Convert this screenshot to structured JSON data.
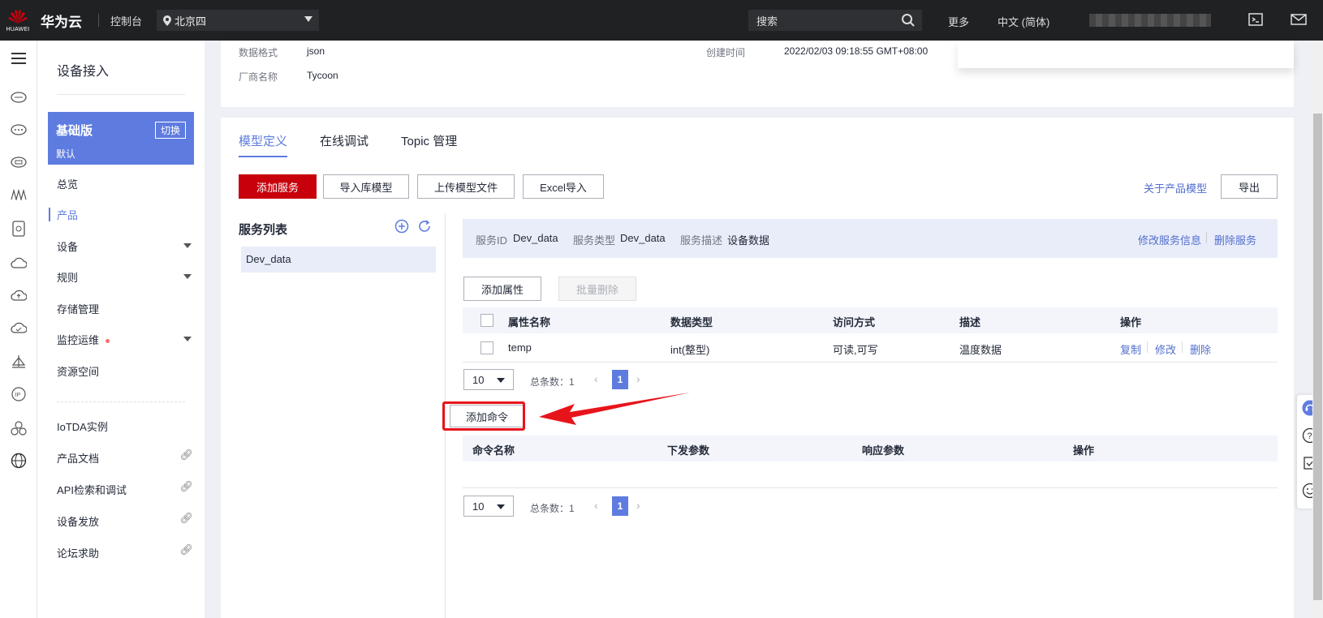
{
  "topbar": {
    "logo_text": "HUAWEI",
    "brand": "华为云",
    "console": "控制台",
    "region": "北京四",
    "search_placeholder": "搜索",
    "more": "更多",
    "language": "中文 (简体)"
  },
  "sidebar": {
    "title": "设备接入",
    "edition": {
      "name": "基础版",
      "sub": "默认",
      "switch": "切换"
    },
    "items": [
      {
        "label": "总览"
      },
      {
        "label": "产品",
        "active": true
      },
      {
        "label": "设备",
        "dropdown": true
      },
      {
        "label": "规则",
        "dropdown": true
      },
      {
        "label": "存储管理"
      },
      {
        "label": "监控运维",
        "dropdown": true,
        "dot": true
      },
      {
        "label": "资源空间"
      },
      {
        "label": "IoTDA实例"
      },
      {
        "label": "产品文档",
        "external": true
      },
      {
        "label": "API检索和调试",
        "external": true
      },
      {
        "label": "设备发放",
        "external": true
      },
      {
        "label": "论坛求助",
        "external": true
      }
    ]
  },
  "info": {
    "format_label": "数据格式",
    "format_value": "json",
    "vendor_label": "厂商名称",
    "vendor_value": "Tycoon",
    "created_label": "创建时间",
    "created_value": "2022/02/03 09:18:55 GMT+08:00"
  },
  "tabs": [
    "模型定义",
    "在线调试",
    "Topic 管理"
  ],
  "toolbar": {
    "add_service": "添加服务",
    "import_lib": "导入库模型",
    "upload_model": "上传模型文件",
    "excel_import": "Excel导入",
    "about_model": "关于产品模型",
    "export": "导出"
  },
  "service_list": {
    "title": "服务列表",
    "items": [
      "Dev_data"
    ]
  },
  "service_detail": {
    "id_label": "服务ID",
    "id_value": "Dev_data",
    "type_label": "服务类型",
    "type_value": "Dev_data",
    "desc_label": "服务描述",
    "desc_value": "设备数据",
    "edit": "修改服务信息",
    "delete": "删除服务"
  },
  "properties": {
    "add": "添加属性",
    "batch_delete": "批量删除",
    "columns": [
      "属性名称",
      "数据类型",
      "访问方式",
      "描述",
      "操作"
    ],
    "rows": [
      {
        "name": "temp",
        "type": "int(整型)",
        "access": "可读,可写",
        "desc": "温度数据",
        "actions": [
          "复制",
          "修改",
          "删除"
        ]
      }
    ],
    "pager": {
      "size": "10",
      "total": "总条数：1",
      "page": "1"
    }
  },
  "commands": {
    "add": "添加命令",
    "columns": [
      "命令名称",
      "下发参数",
      "响应参数",
      "操作"
    ],
    "pager": {
      "size": "10",
      "total": "总条数：1",
      "page": "1"
    }
  },
  "colors": {
    "accent": "#5e7ce0",
    "primary_red": "#c7000b",
    "annotation_red": "#e8141b"
  }
}
